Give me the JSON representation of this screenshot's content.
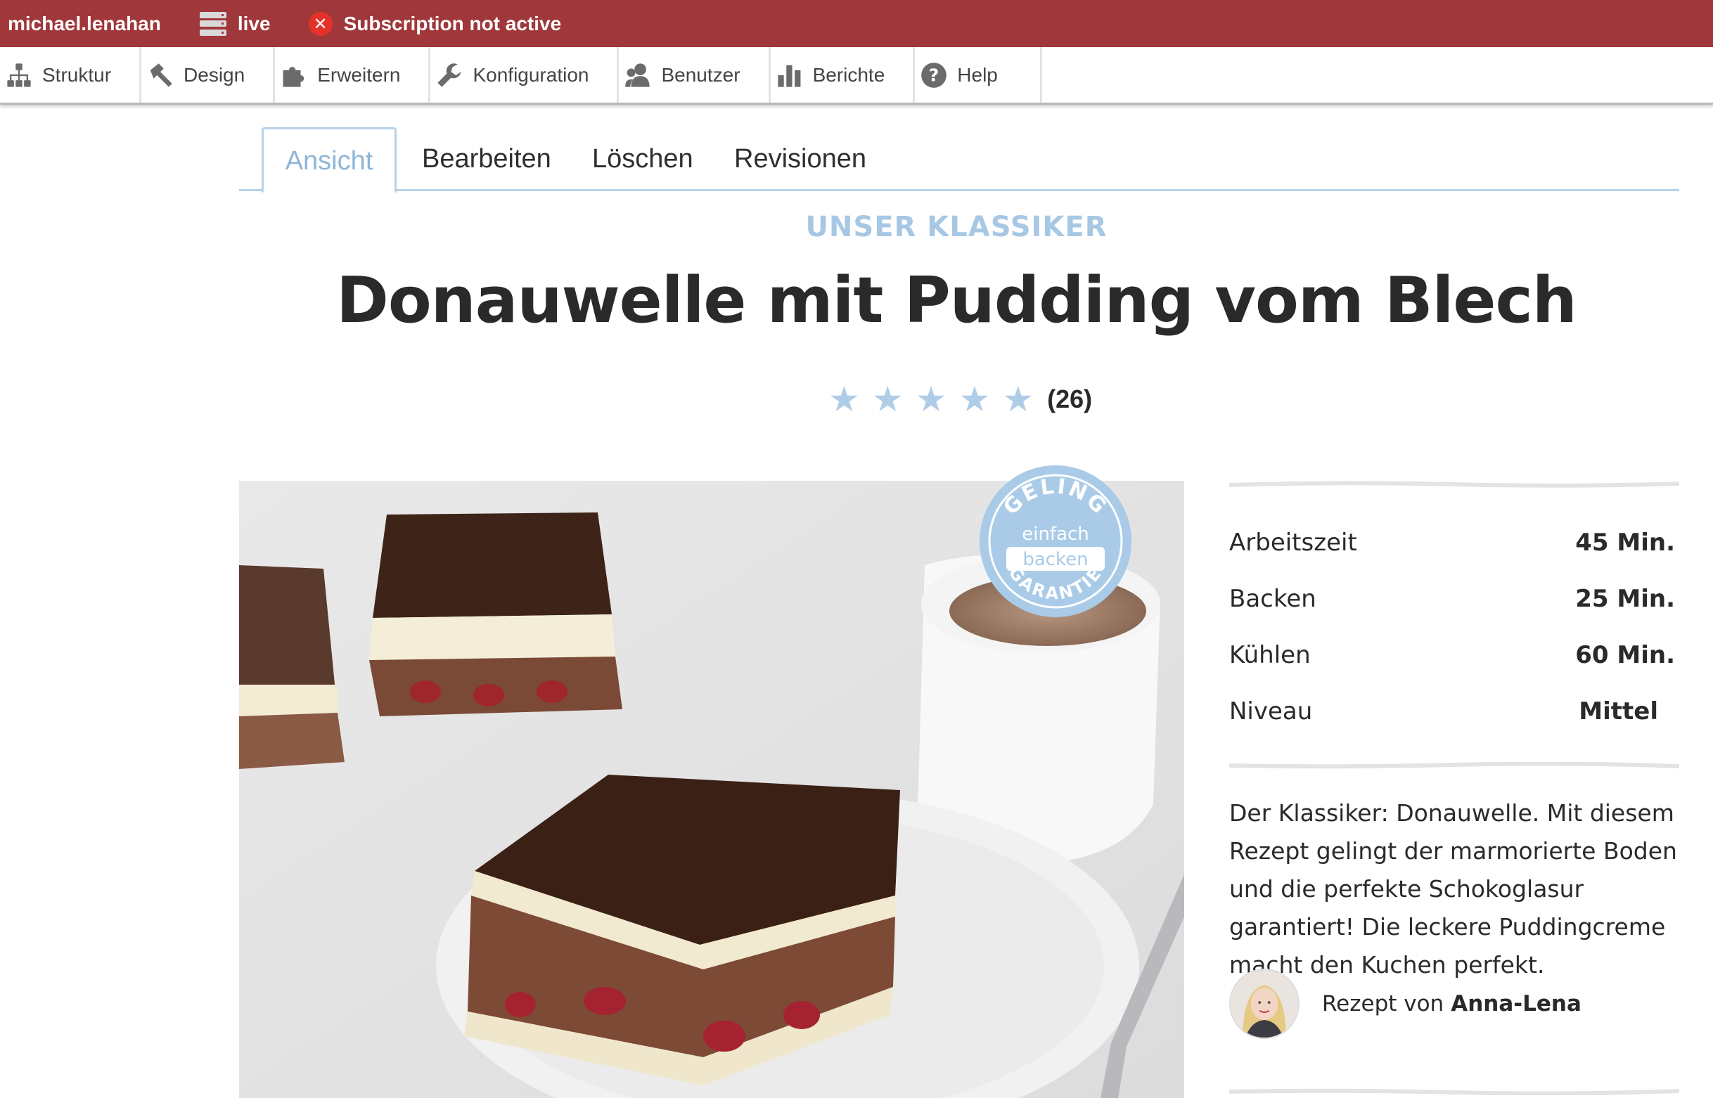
{
  "admin_bar": {
    "username": "michael.lenahan",
    "environment": "live",
    "subscription_status": "Subscription not active",
    "status_icon": "error-x-icon",
    "background_color": "#a0373a"
  },
  "toolbar": {
    "items": [
      {
        "label": "Struktur",
        "icon": "structure-icon"
      },
      {
        "label": "Design",
        "icon": "hammer-icon"
      },
      {
        "label": "Erweitern",
        "icon": "puzzle-icon"
      },
      {
        "label": "Konfiguration",
        "icon": "wrench-icon"
      },
      {
        "label": "Benutzer",
        "icon": "people-icon"
      },
      {
        "label": "Berichte",
        "icon": "bar-chart-icon"
      },
      {
        "label": "Help",
        "icon": "help-icon"
      }
    ]
  },
  "tabs": [
    {
      "label": "Ansicht",
      "active": true
    },
    {
      "label": "Bearbeiten",
      "active": false
    },
    {
      "label": "Löschen",
      "active": false
    },
    {
      "label": "Revisionen",
      "active": false
    }
  ],
  "recipe": {
    "kicker": "UNSER KLASSIKER",
    "title": "Donauwelle mit Pudding vom Blech",
    "rating": {
      "stars": 5,
      "count": "(26)"
    },
    "badge": {
      "top": "GELING",
      "middle1": "einfach",
      "middle2": "backen",
      "bottom": "GARANTIE"
    },
    "facts": [
      {
        "label": "Arbeitszeit",
        "value": "45 Min."
      },
      {
        "label": "Backen",
        "value": "25 Min."
      },
      {
        "label": "Kühlen",
        "value": "60 Min."
      },
      {
        "label": "Niveau",
        "value": "Mittel"
      }
    ],
    "description": "Der Klassiker: Donauwelle. Mit diesem Rezept gelingt der marmorierte Boden und die perfekte Schokoglasur garantiert! Die leckere Puddingcreme macht den Kuchen perfekt.",
    "author": {
      "prefix": "Rezept von",
      "name": "Anna-Lena"
    },
    "accent_color": "#a7c8e4"
  }
}
